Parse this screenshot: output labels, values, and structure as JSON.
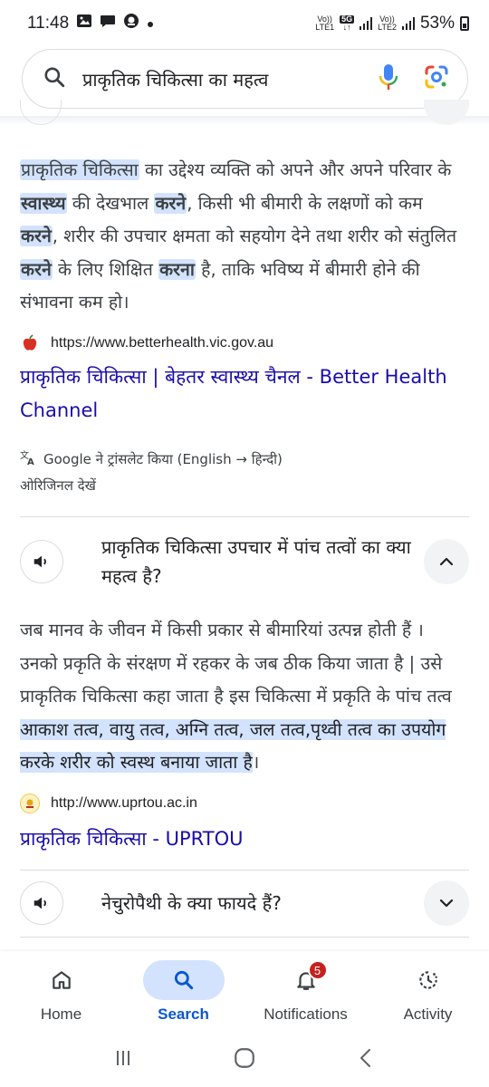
{
  "status_bar": {
    "time": "11:48",
    "sim1_top": "Vo))",
    "sim1_bottom": "LTE1",
    "network": "5G",
    "sim2_top": "Vo))",
    "sim2_bottom": "LTE2",
    "battery": "53%"
  },
  "search": {
    "query": "प्राकृतिक चिकित्सा का महत्व"
  },
  "result1": {
    "snippet_parts": {
      "p1": "प्राकृतिक चिकित्सा",
      "p2": " का उद्देश्य व्यक्ति को अपने और अपने परिवार के ",
      "p3": "स्वास्थ्य",
      "p4": " की देखभाल ",
      "p5": "करने",
      "p6": ", किसी भी बीमारी के लक्षणों को कम ",
      "p7": "करने",
      "p8": ", शरीर की उपचार क्षमता को सहयोग देने तथा शरीर को संतुलित ",
      "p9": "करने",
      "p10": " के लिए शिक्षित ",
      "p11": "करना",
      "p12": " है, ताकि भविष्य में बीमारी होने की संभावना कम हो।"
    },
    "source_url": "https://www.betterhealth.vic.gov.au",
    "title": "प्राकृतिक चिकित्सा | बेहतर स्वास्थ्य चैनल - Better Health Channel",
    "translate_note": "Google ने ट्रांसलेट किया (English → हिन्दी)",
    "original_link": "ओरिजिनल देखें"
  },
  "faq1": {
    "question": "प्राकृतिक चिकित्सा उपचार में पांच तत्वों का क्या महत्व है?",
    "answer_plain": "जब मानव के जीवन में किसी प्रकार से बीमारियां उत्पन्न होती हैं । उनको प्रकृति के संरक्षण में रहकर के जब ठीक किया जाता है | उसे प्राकृतिक चिकित्सा कहा जाता है इस चिकित्सा में प्रकृति के पांच तत्व ",
    "answer_highlight": "आकाश तत्व, वायु तत्व, अग्नि तत्व, जल तत्व,पृथ्वी तत्व का उपयोग करके शरीर को स्वस्थ बनाया जाता है",
    "answer_end": "।",
    "source_url": "http://www.uprtou.ac.in",
    "title": "प्राकृतिक चिकित्सा - UPRTOU"
  },
  "faq2": {
    "question": "नेचुरोपैथी के क्या फायदे हैं?"
  },
  "bottom_nav": {
    "items": [
      {
        "label": "Home",
        "icon": "home-icon"
      },
      {
        "label": "Search",
        "icon": "search-icon"
      },
      {
        "label": "Notifications",
        "icon": "bell-icon"
      },
      {
        "label": "Activity",
        "icon": "activity-icon"
      }
    ],
    "active": "Search",
    "notification_count": "5"
  },
  "colors": {
    "link": "#1a0dab",
    "highlight": "#d3e3fd",
    "active_nav": "#0b57d0",
    "badge": "#c5221f"
  }
}
